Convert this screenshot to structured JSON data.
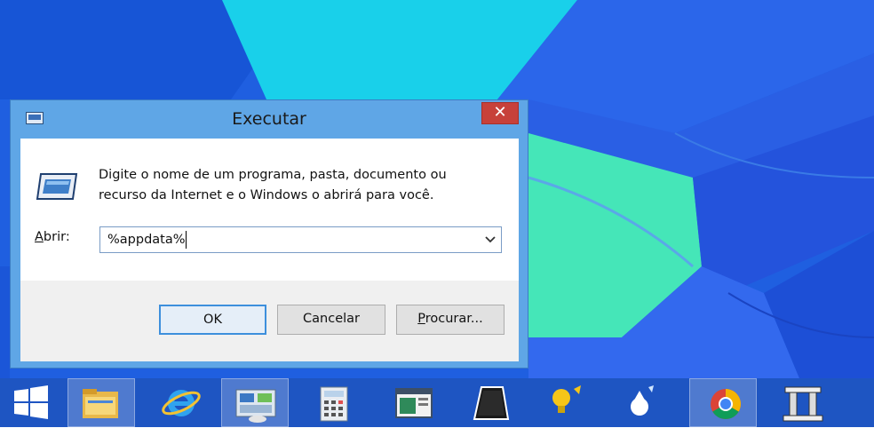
{
  "dialog": {
    "title": "Executar",
    "close_symbol": "✕",
    "description_line1": "Digite o nome de um programa, pasta, documento ou",
    "description_line2": "recurso da Internet e o Windows o abrirá para você.",
    "open_label_accesskey": "A",
    "open_label_rest": "brir:",
    "input_value": "%appdata%",
    "ok_label": "OK",
    "cancel_label": "Cancelar",
    "browse_label_accesskey": "P",
    "browse_label_rest": "rocurar..."
  },
  "taskbar": {
    "items": [
      {
        "name": "start-button",
        "icon": "windows-logo-icon"
      },
      {
        "name": "file-explorer",
        "icon": "folder-icon",
        "active": true
      },
      {
        "name": "internet-explorer",
        "icon": "internet-explorer-icon"
      },
      {
        "name": "control-panel",
        "icon": "control-panel-icon",
        "active": true
      },
      {
        "name": "calculator",
        "icon": "calculator-icon"
      },
      {
        "name": "app-window",
        "icon": "window-app-icon"
      },
      {
        "name": "app-dark",
        "icon": "dark-shape-icon"
      },
      {
        "name": "app-bulb",
        "icon": "lightbulb-icon"
      },
      {
        "name": "app-drop",
        "icon": "droplet-icon"
      },
      {
        "name": "chrome",
        "icon": "chrome-icon",
        "active": true
      },
      {
        "name": "app-pillar",
        "icon": "pillar-icon"
      }
    ]
  },
  "colors": {
    "taskbar": "#1e55c2",
    "dialog_frame": "#5fa6e6",
    "close_button": "#c7413a",
    "ok_border": "#3d8fdc"
  }
}
